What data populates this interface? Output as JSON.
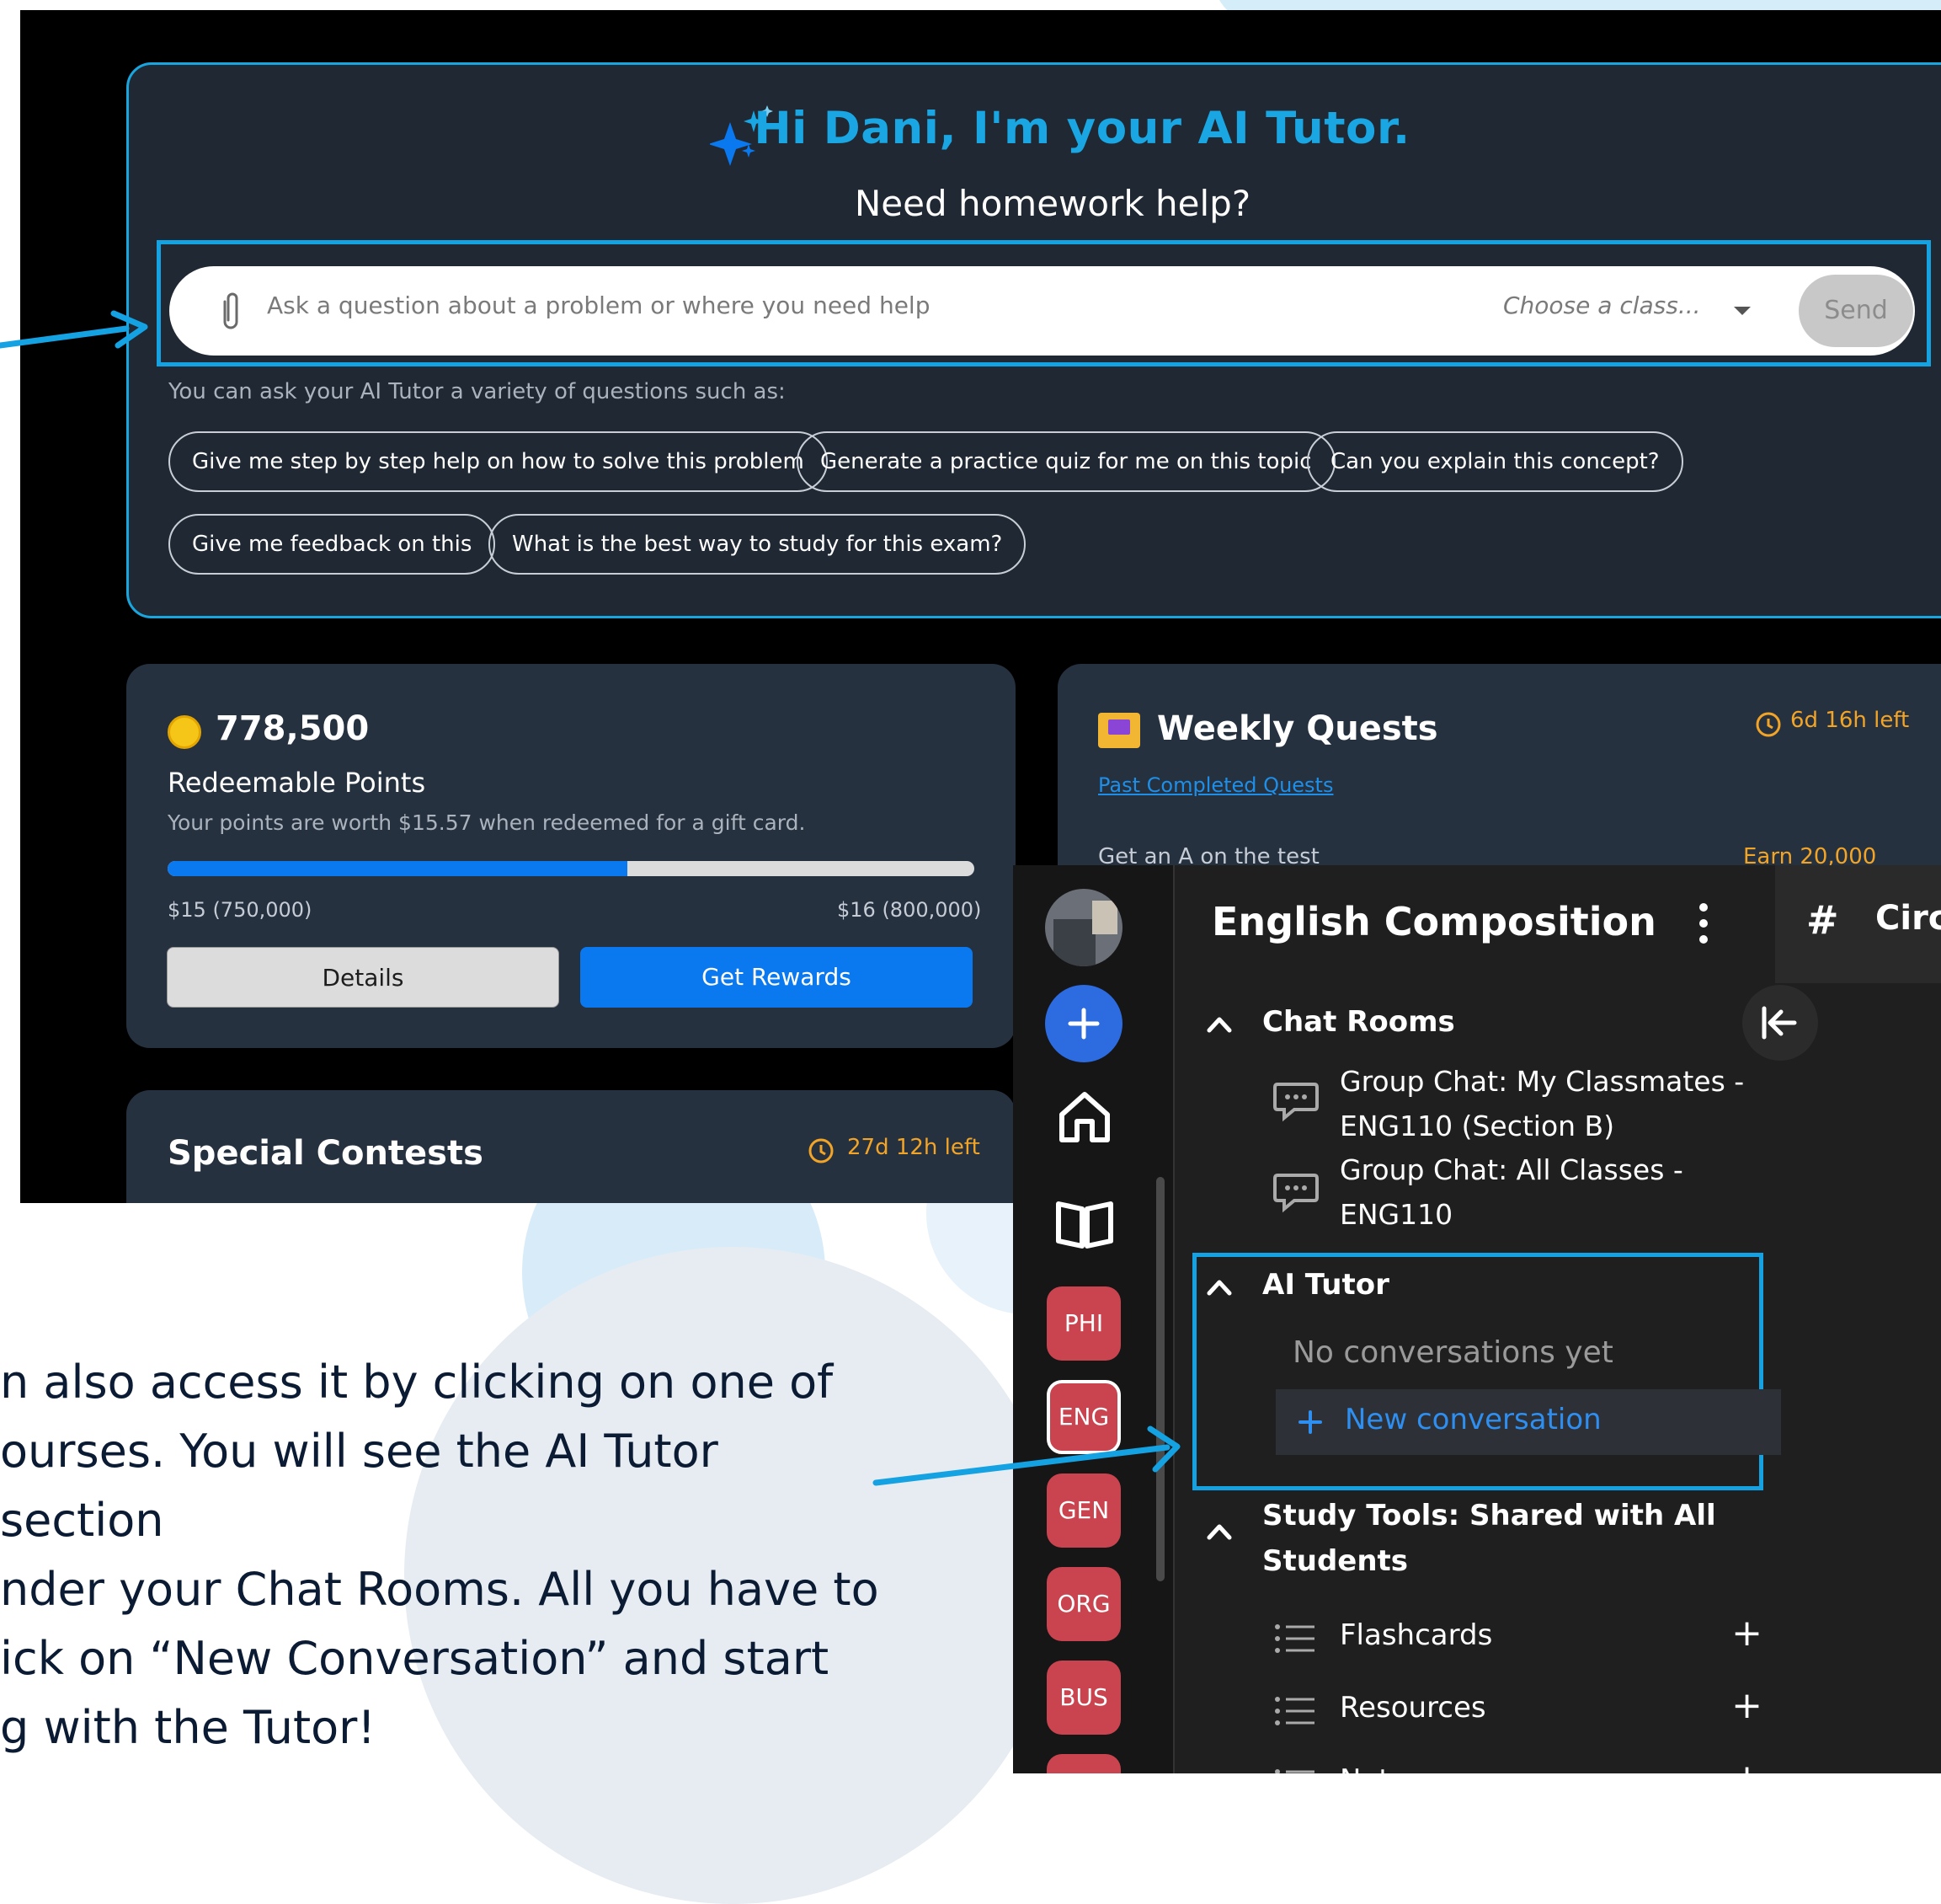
{
  "tutor": {
    "title": "Hi Dani, I'm your AI Tutor.",
    "subtitle": "Need homework help?",
    "input_placeholder": "Ask a question about a problem or where you need help",
    "class_select": "Choose a class...",
    "send_label": "Send",
    "hint": "You can ask your AI Tutor a variety of questions such as:",
    "chips": [
      "Give me step by step help on how to solve this problem",
      "Generate a practice quiz for me on this topic",
      "Can you explain this concept?",
      "Give me feedback on this",
      "What is the best way to study for this exam?"
    ]
  },
  "points": {
    "amount": "778,500",
    "label": "Redeemable Points",
    "description": "Your points are worth $15.57 when redeemed for a gift card.",
    "progress": 0.57,
    "min_label": "$15 (750,000)",
    "max_label": "$16 (800,000)",
    "details_label": "Details",
    "rewards_label": "Get Rewards"
  },
  "quests": {
    "title": "Weekly Quests",
    "time_left": "6d 16h left",
    "past_link": "Past Completed Quests",
    "first_quest": "Get an A on the test",
    "first_earn": "Earn 20,000"
  },
  "contests": {
    "title": "Special Contests",
    "time_left": "27d 12h left"
  },
  "sidebar": {
    "course_title": "English Composition",
    "channel_label": "Circ",
    "chat_rooms_header": "Chat Rooms",
    "chat_rooms": [
      {
        "line1": "Group Chat: My Classmates -",
        "line2": "ENG110 (Section B)"
      },
      {
        "line1": "Group Chat: All Classes -",
        "line2": "ENG110"
      }
    ],
    "ai_tutor_header": "AI Tutor",
    "no_conversations": "No conversations yet",
    "new_conversation": "New conversation",
    "study_tools_line1": "Study Tools: Shared with All",
    "study_tools_line2": "Students",
    "study_tools": [
      "Flashcards",
      "Resources",
      "Notes"
    ],
    "courses": [
      "PHI",
      "ENG",
      "GEN",
      "ORG",
      "BUS"
    ]
  },
  "instructions": {
    "line1": "n also access it by clicking on one of",
    "line2": "ourses. You will see the AI Tutor section",
    "line3": "nder your Chat Rooms. All you have to",
    "line4": "ick on “New Conversation” and start",
    "line5": "g with the Tutor!"
  },
  "colors": {
    "accent_blue": "#14a2e3",
    "primary_button": "#0a78ee",
    "course_pill": "#c9444f",
    "dark_card": "#263140"
  }
}
